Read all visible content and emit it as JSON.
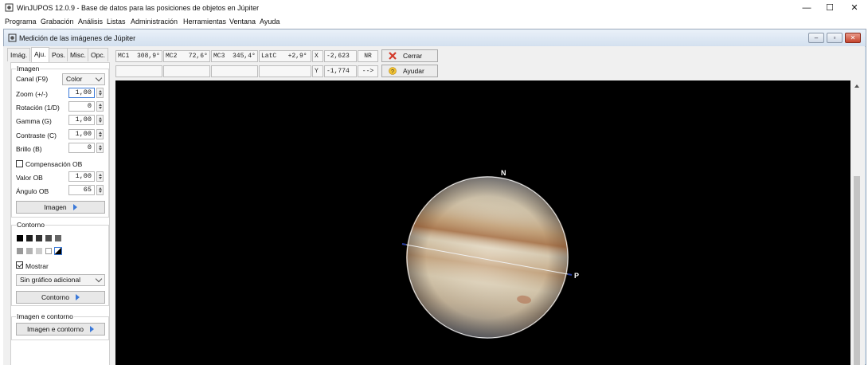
{
  "window": {
    "title": "WinJUPOS 12.0.9 - Base de datos para las posiciones de objetos en Júpiter",
    "controls": {
      "minimize": "—",
      "maximize": "☐",
      "close": "✕"
    }
  },
  "menu": [
    "Programa",
    "Grabación",
    "Análisis",
    "Listas",
    "Administración",
    "Herramientas",
    "Ventana",
    "Ayuda"
  ],
  "child_window": {
    "title": "Medición de las imágenes de Júpiter"
  },
  "tabs": [
    "Imág.",
    "Aju.",
    "Pos.",
    "Misc.",
    "Opc."
  ],
  "active_tab": "Aju.",
  "imagen_group": {
    "label": "Imagen",
    "canal_label": "Canal (F9)",
    "canal_value": "Color",
    "fields": [
      {
        "label": "Zoom (+/-)",
        "value": "1,00"
      },
      {
        "label": "Rotación (1/D)",
        "value": "0"
      },
      {
        "label": "Gamma (G)",
        "value": "1,00"
      },
      {
        "label": "Contraste (C)",
        "value": "1,00"
      },
      {
        "label": "Brillo (B)",
        "value": "0"
      }
    ],
    "compensacion_label": "Compensación OB",
    "compensacion_checked": false,
    "valor_ob_label": "Valor OB",
    "valor_ob_value": "1,00",
    "angulo_ob_label": "Ángulo OB",
    "angulo_ob_value": "65",
    "button": "Imagen"
  },
  "contorno_group": {
    "label": "Contorno",
    "swatches_row1": [
      "#000000",
      "#1e1e1e",
      "#333333",
      "#4d4d4d",
      "#666666"
    ],
    "swatches_row2": [
      "#999999",
      "#b3b3b3",
      "#cccccc",
      "#ffffff",
      "mixed"
    ],
    "mostrar_label": "Mostrar",
    "mostrar_checked": true,
    "grafico_value": "Sin gráfico adicional",
    "button": "Contorno"
  },
  "imagen_contorno_group": {
    "label": "Imagen e contorno",
    "button": "Imagen e contorno"
  },
  "measurements": {
    "row1": [
      "MC1  308,9°",
      "MC2   72,6°",
      "MC3  345,4°",
      "LatC   +2,9°",
      "X",
      "-2,623",
      "NR"
    ],
    "row2": [
      "",
      "",
      "",
      "",
      "Y",
      "-1,774",
      "-->"
    ]
  },
  "buttons": {
    "close": "Cerrar",
    "help": "Ayudar"
  },
  "planet_labels": {
    "north": "N",
    "p": "P"
  }
}
